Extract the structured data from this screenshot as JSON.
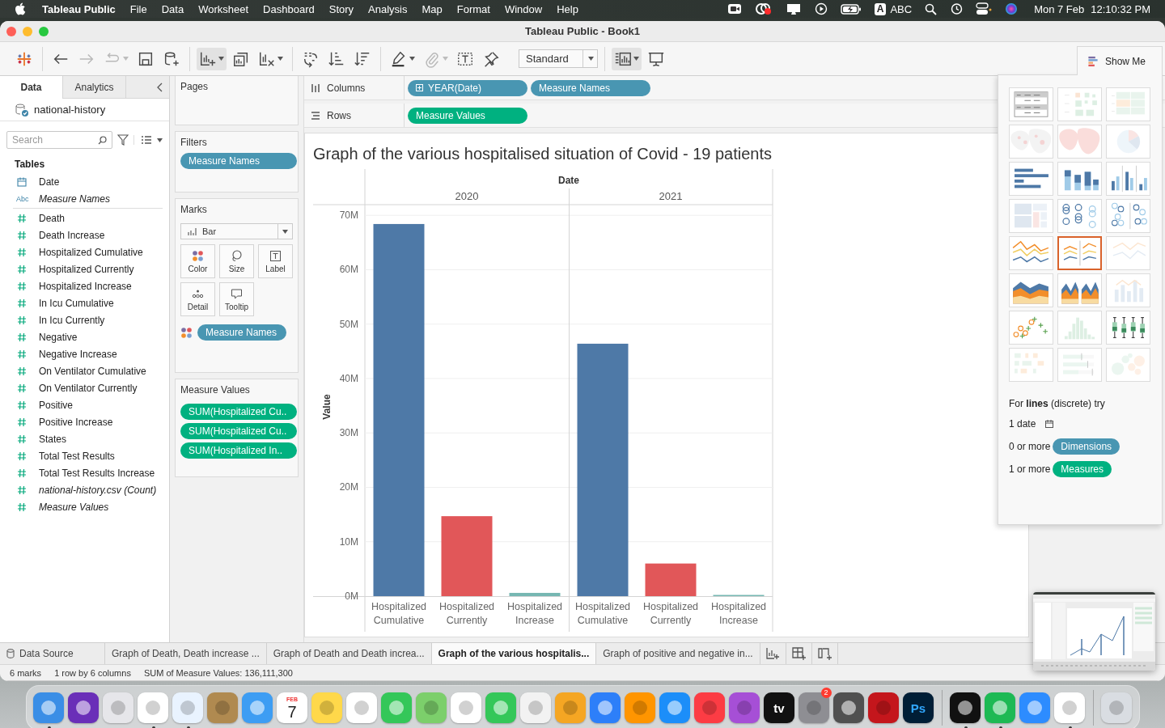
{
  "menubar": {
    "app": "Tableau Public",
    "menus": [
      "File",
      "Data",
      "Worksheet",
      "Dashboard",
      "Story",
      "Analysis",
      "Map",
      "Format",
      "Window",
      "Help"
    ],
    "input_key": "A",
    "input_label": "ABC",
    "date": "Mon 7 Feb",
    "time": "12:10:32 PM"
  },
  "window": {
    "title": "Tableau Public - Book1"
  },
  "toolbar": {
    "groups": [
      [
        {
          "kind": "logo",
          "disabled": false,
          "caret": false,
          "pressed": false
        }
      ],
      [
        {
          "kind": "back",
          "disabled": false,
          "caret": false,
          "pressed": false
        },
        {
          "kind": "forward",
          "disabled": true,
          "caret": false,
          "pressed": false
        },
        {
          "kind": "replay",
          "disabled": true,
          "caret": true,
          "pressed": false
        },
        {
          "kind": "save",
          "disabled": false,
          "caret": false,
          "pressed": false
        },
        {
          "kind": "add-datasource",
          "disabled": false,
          "caret": false,
          "pressed": false
        }
      ],
      [
        {
          "kind": "new-worksheet",
          "disabled": false,
          "caret": true,
          "pressed": true
        },
        {
          "kind": "duplicate",
          "disabled": false,
          "caret": false,
          "pressed": false
        },
        {
          "kind": "clear",
          "disabled": false,
          "caret": true,
          "pressed": false
        }
      ],
      [
        {
          "kind": "swap",
          "disabled": false,
          "caret": false,
          "pressed": false
        },
        {
          "kind": "sort-ascending",
          "disabled": false,
          "caret": false,
          "pressed": false
        },
        {
          "kind": "sort-descending",
          "disabled": false,
          "caret": false,
          "pressed": false
        }
      ],
      [
        {
          "kind": "highlight",
          "disabled": false,
          "caret": true,
          "pressed": false
        },
        {
          "kind": "annotate",
          "disabled": true,
          "caret": true,
          "pressed": false
        },
        {
          "kind": "labels",
          "disabled": false,
          "caret": false,
          "pressed": false
        },
        {
          "kind": "pin",
          "disabled": false,
          "caret": false,
          "pressed": false
        }
      ],
      [
        {
          "kind": "show-cards",
          "disabled": false,
          "caret": true,
          "pressed": true
        },
        {
          "kind": "presentation",
          "disabled": false,
          "caret": false,
          "pressed": false
        }
      ]
    ],
    "fit": "Standard"
  },
  "data_pane": {
    "tabs": [
      {
        "label": "Data",
        "selected": true
      },
      {
        "label": "Analytics",
        "selected": false
      }
    ],
    "datasource": "national-history",
    "search": {
      "placeholder": "Search"
    },
    "section": "Tables",
    "fields": [
      {
        "name": "Date",
        "kind": "date",
        "italic": false
      },
      {
        "name": "Measure Names",
        "kind": "text",
        "badge": "Abc",
        "italic": true
      },
      {
        "name": "Death",
        "kind": "number",
        "italic": false
      },
      {
        "name": "Death Increase",
        "kind": "number",
        "italic": false
      },
      {
        "name": "Hospitalized Cumulative",
        "kind": "number",
        "italic": false
      },
      {
        "name": "Hospitalized Currently",
        "kind": "number",
        "italic": false
      },
      {
        "name": "Hospitalized Increase",
        "kind": "number",
        "italic": false
      },
      {
        "name": "In Icu Cumulative",
        "kind": "number",
        "italic": false
      },
      {
        "name": "In Icu Currently",
        "kind": "number",
        "italic": false
      },
      {
        "name": "Negative",
        "kind": "number",
        "italic": false
      },
      {
        "name": "Negative Increase",
        "kind": "number",
        "italic": false
      },
      {
        "name": "On Ventilator Cumulative",
        "kind": "number",
        "italic": false
      },
      {
        "name": "On Ventilator Currently",
        "kind": "number",
        "italic": false
      },
      {
        "name": "Positive",
        "kind": "number",
        "italic": false
      },
      {
        "name": "Positive Increase",
        "kind": "number",
        "italic": false
      },
      {
        "name": "States",
        "kind": "number",
        "italic": false
      },
      {
        "name": "Total Test Results",
        "kind": "number",
        "italic": false
      },
      {
        "name": "Total Test Results Increase",
        "kind": "number",
        "italic": false
      },
      {
        "name": "national-history.csv (Count)",
        "kind": "number",
        "italic": true
      },
      {
        "name": "Measure Values",
        "kind": "number",
        "italic": true
      }
    ]
  },
  "cards": {
    "pages": {
      "title": "Pages"
    },
    "filters": {
      "title": "Filters",
      "pills": [
        {
          "label": "Measure Names",
          "kind": "dimension"
        }
      ]
    },
    "marks": {
      "title": "Marks",
      "mark_type": "Bar",
      "buttons": [
        {
          "label": "Color",
          "kind": "color"
        },
        {
          "label": "Size",
          "kind": "size"
        },
        {
          "label": "Label",
          "kind": "label"
        },
        {
          "label": "Detail",
          "kind": "detail"
        },
        {
          "label": "Tooltip",
          "kind": "tooltip"
        }
      ],
      "encodings": [
        {
          "kind": "color",
          "pill": {
            "label": "Measure Names",
            "kind": "dimension"
          }
        }
      ]
    },
    "measure_values": {
      "title": "Measure Values",
      "pills": [
        {
          "label": "SUM(Hospitalized Cu..",
          "kind": "measure"
        },
        {
          "label": "SUM(Hospitalized Cu..",
          "kind": "measure"
        },
        {
          "label": "SUM(Hospitalized In..",
          "kind": "measure"
        }
      ]
    }
  },
  "shelves": [
    {
      "label": "Columns",
      "kind": "columns",
      "pills": [
        {
          "label": "YEAR(Date)",
          "kind": "dimension",
          "expandable": true
        },
        {
          "label": "Measure Names",
          "kind": "dimension",
          "expandable": false
        }
      ]
    },
    {
      "label": "Rows",
      "kind": "rows",
      "pills": [
        {
          "label": "Measure Values",
          "kind": "measure",
          "expandable": false
        }
      ]
    }
  ],
  "worksheet": {
    "title": "Graph of the various hospitalised situation of Covid - 19 patients",
    "chart_data": {
      "type": "bar",
      "xlabel": "Date",
      "ylabel": "Value",
      "categories": [
        "2020",
        "2021"
      ],
      "series": [
        {
          "name": "Hospitalized Cumulative",
          "color": "#4e79a7",
          "values": [
            68400000,
            46400000
          ]
        },
        {
          "name": "Hospitalized Currently",
          "color": "#e15759",
          "values": [
            14700000,
            6000000
          ]
        },
        {
          "name": "Hospitalized Increase",
          "color": "#76b7b2",
          "values": [
            600000,
            100000
          ]
        }
      ],
      "ylim": [
        0,
        78500000
      ],
      "grid": true,
      "yticks": [
        {
          "value": 0,
          "label": "0M"
        },
        {
          "value": 10000000,
          "label": "10M"
        },
        {
          "value": 20000000,
          "label": "20M"
        },
        {
          "value": 30000000,
          "label": "30M"
        },
        {
          "value": 40000000,
          "label": "40M"
        },
        {
          "value": 50000000,
          "label": "50M"
        },
        {
          "value": 60000000,
          "label": "60M"
        },
        {
          "value": 70000000,
          "label": "70M"
        }
      ]
    }
  },
  "show_me": {
    "button": "Show Me",
    "thumbnails": [
      {
        "kind": "text-table",
        "enabled": true,
        "selected": false
      },
      {
        "kind": "heat-map",
        "enabled": false,
        "selected": false
      },
      {
        "kind": "highlight-table",
        "enabled": false,
        "selected": false
      },
      {
        "kind": "symbol-map",
        "enabled": false,
        "selected": false
      },
      {
        "kind": "filled-map",
        "enabled": false,
        "selected": false
      },
      {
        "kind": "pie",
        "enabled": false,
        "selected": false
      },
      {
        "kind": "hbar",
        "enabled": true,
        "selected": false
      },
      {
        "kind": "stacked-bar",
        "enabled": true,
        "selected": false
      },
      {
        "kind": "side-bar",
        "enabled": true,
        "selected": false
      },
      {
        "kind": "treemap",
        "enabled": false,
        "selected": false
      },
      {
        "kind": "circle",
        "enabled": true,
        "selected": false
      },
      {
        "kind": "side-circle",
        "enabled": true,
        "selected": false
      },
      {
        "kind": "line-cont",
        "enabled": true,
        "selected": false
      },
      {
        "kind": "line-disc",
        "enabled": true,
        "selected": true
      },
      {
        "kind": "dual-line",
        "enabled": false,
        "selected": false
      },
      {
        "kind": "area-cont",
        "enabled": true,
        "selected": false
      },
      {
        "kind": "area-disc",
        "enabled": true,
        "selected": false
      },
      {
        "kind": "dual-combo",
        "enabled": false,
        "selected": false
      },
      {
        "kind": "scatter",
        "enabled": true,
        "selected": false
      },
      {
        "kind": "histogram",
        "enabled": false,
        "selected": false
      },
      {
        "kind": "box-plot",
        "enabled": true,
        "selected": false
      },
      {
        "kind": "gantt",
        "enabled": false,
        "selected": false
      },
      {
        "kind": "bullet",
        "enabled": false,
        "selected": false
      },
      {
        "kind": "bubbles",
        "enabled": false,
        "selected": false
      }
    ],
    "hint": "For **lines** (discrete) try",
    "requirements": [
      {
        "text": "1 date",
        "kind": "date"
      },
      {
        "text": "0 or more",
        "pill": "Dimensions",
        "kind": "dimension"
      },
      {
        "text": "1 or more",
        "pill": "Measures",
        "kind": "measure"
      }
    ]
  },
  "sheet_tabs": {
    "data_source": "Data Source",
    "sheets": [
      {
        "label": "Graph of Death, Death increase ...",
        "selected": false
      },
      {
        "label": "Graph of Death and Death increa...",
        "selected": false
      },
      {
        "label": "Graph of the various hospitalis...",
        "selected": true
      },
      {
        "label": "Graph of positive and negative in...",
        "selected": false
      }
    ]
  },
  "status_bar": [
    "6 marks",
    "1 row by 6 columns",
    "SUM of Measure Values: 136,111,300"
  ],
  "dock": {
    "groups": [
      [
        {
          "color": "#3a8ee6",
          "running": true
        },
        {
          "color": "#6a2fb8",
          "running": false
        },
        {
          "color": "#e6e6ea",
          "running": false
        },
        {
          "color": "#ffffff",
          "running": true
        },
        {
          "color": "#e9f3ff",
          "running": true
        },
        {
          "color": "#b08a50",
          "running": false
        },
        {
          "color": "#3d9df3",
          "running": false
        },
        {
          "color": "#ffffff",
          "running": false,
          "month": "FEB",
          "day": "7"
        },
        {
          "color": "#ffd84a",
          "running": false
        },
        {
          "color": "#ffffff",
          "running": false
        },
        {
          "color": "#34c759",
          "running": false
        },
        {
          "color": "#7ccf6b",
          "running": false
        },
        {
          "color": "#ffffff",
          "running": false
        },
        {
          "color": "#34c759",
          "running": false
        },
        {
          "color": "#f2f2f2",
          "running": false
        },
        {
          "color": "#f5a623",
          "running": false
        },
        {
          "color": "#2d7ff9",
          "running": false
        },
        {
          "color": "#ff9500",
          "running": false
        },
        {
          "color": "#1c8ef9",
          "running": false
        },
        {
          "color": "#fc3c44",
          "running": false
        },
        {
          "color": "#a64fd6",
          "running": false
        },
        {
          "color": "#111111",
          "running": false,
          "label": "tv"
        },
        {
          "color": "#8e8e93",
          "running": false,
          "badge": "2"
        },
        {
          "color": "#505050",
          "running": false
        },
        {
          "color": "#c4161c",
          "running": false
        },
        {
          "color": "#001e36",
          "running": false,
          "label": "Ps"
        }
      ],
      [
        {
          "color": "#111111",
          "running": true
        },
        {
          "color": "#1db954",
          "running": true
        },
        {
          "color": "#2d8cff",
          "running": false
        },
        {
          "color": "#ffffff",
          "running": true
        }
      ],
      [
        {
          "color": "#d9dde2",
          "running": false
        }
      ]
    ]
  }
}
